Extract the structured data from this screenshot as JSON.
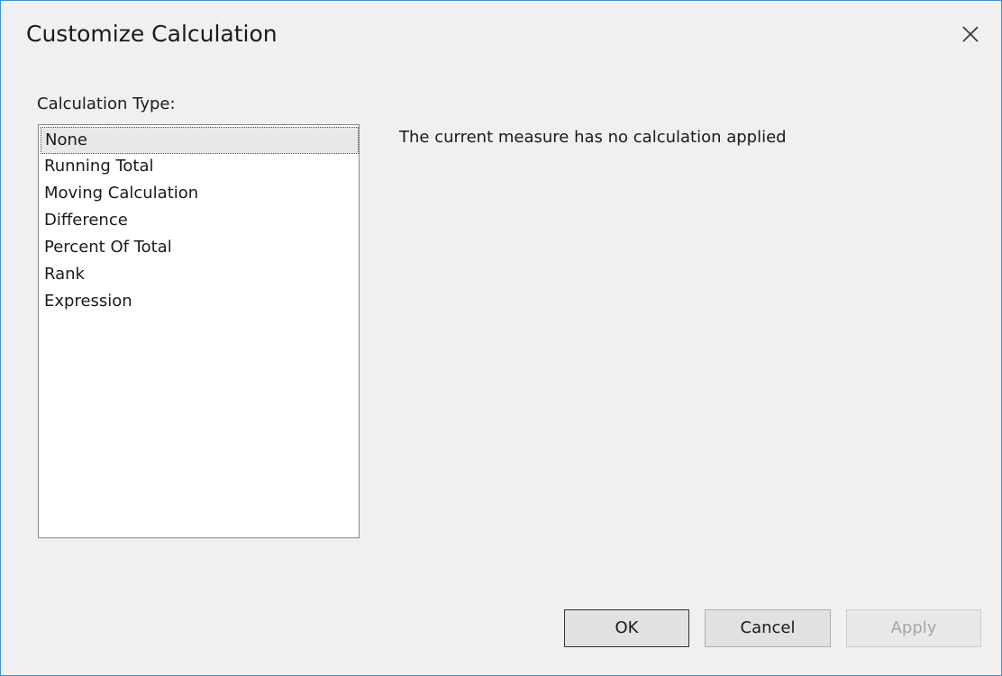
{
  "dialog": {
    "title": "Customize Calculation",
    "close_icon": "close-icon"
  },
  "calculation_type": {
    "label": "Calculation Type:",
    "items": [
      {
        "label": "None",
        "selected": true
      },
      {
        "label": "Running Total",
        "selected": false
      },
      {
        "label": "Moving Calculation",
        "selected": false
      },
      {
        "label": "Difference",
        "selected": false
      },
      {
        "label": "Percent Of Total",
        "selected": false
      },
      {
        "label": "Rank",
        "selected": false
      },
      {
        "label": "Expression",
        "selected": false
      }
    ]
  },
  "description": {
    "text": "The current measure has no calculation applied"
  },
  "buttons": {
    "ok_label": "OK",
    "cancel_label": "Cancel",
    "apply_label": "Apply",
    "apply_enabled": false
  },
  "colors": {
    "window_border": "#3c8fd6",
    "background": "#f0f0f0",
    "list_background": "#ffffff",
    "disabled_text": "#a6a6a6"
  }
}
